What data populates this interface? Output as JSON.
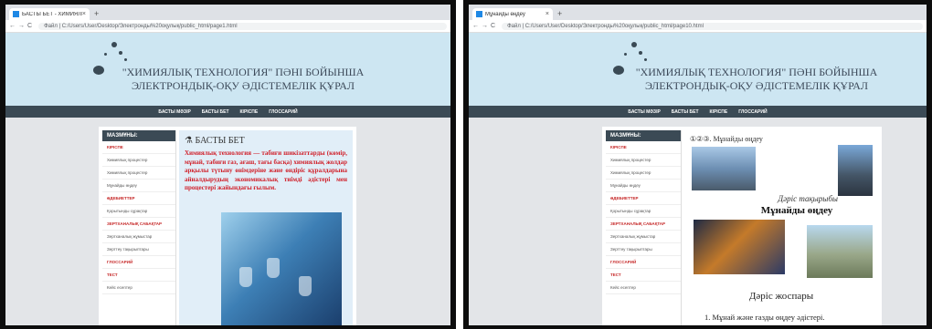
{
  "left": {
    "tab_title": "БАСТЫ БЕТ - ХИМИЯЛЫҚ Т",
    "address": "Файл | C:/Users/User/Desktop/Электронды%20оқулық/public_html/page1.html",
    "site_title_line1": "\"ХИМИЯЛЫҚ ТЕХНОЛОГИЯ\" ПӘНІ БОЙЫНША",
    "site_title_line2": "ЭЛЕКТРОНДЫҚ-ОҚУ ӘДІСТЕМЕЛІК ҚҰРАЛ",
    "menu": [
      "БАСТЫ МӘЗІР",
      "БАСТЫ БЕТ",
      "КІРІСПЕ",
      "ГЛОССАРИЙ"
    ],
    "sidebar_head": "МАЗМҰНЫ:",
    "sidebar_items": [
      "КІРІСПЕ",
      "Химиялық процестер",
      "Химиялық процестер",
      "Мұнайды өңдеу",
      "ӘДЕБИЕТТЕР",
      "Қорытынды сұрақтар",
      "ЗЕРТХАНАЛЫҚ САБАҚТАР",
      "Зертханалық жұмыстар",
      "Зерттеу тақырыптары",
      "ГЛОССАРИЙ",
      "ТЕСТ",
      "Кейс есептер"
    ],
    "page_heading": "БАСТЫ БЕТ",
    "lead_text": "Химиялық технология — табиғи шикізаттарды (көмір, мұнай, табиғи газ, ағаш, тағы басқа) химиялық жолдар арқылы түтыну өнімдеріне және өндіріс құралдарына айналдырудың экономикалық тиімді әдістері мен процестері жайындағы ғылым."
  },
  "right": {
    "tab_title": "Мұнайды өңдеу",
    "address": "Файл | C:/Users/User/Desktop/Электронды%20оқулық/public_html/page10.html",
    "site_title_line1": "\"ХИМИЯЛЫҚ ТЕХНОЛОГИЯ\" ПӘНІ БОЙЫНША",
    "site_title_line2": "ЭЛЕКТРОНДЫҚ-ОҚУ ӘДІСТЕМЕЛІК ҚҰРАЛ",
    "menu": [
      "БАСТЫ МӘЗІР",
      "БАСТЫ БЕТ",
      "КІРІСПЕ",
      "ГЛОССАРИЙ"
    ],
    "sidebar_head": "МАЗМҰНЫ:",
    "sidebar_items": [
      "КІРІСПЕ",
      "Химиялық процестер",
      "Химиялық процестер",
      "Мұнайды өңдеу",
      "ӘДЕБИЕТТЕР",
      "Қорытынды сұрақтар",
      "ЗЕРТХАНАЛЫҚ САБАҚТАР",
      "Зертханалық жұмыстар",
      "Зерттеу тақырыптары",
      "ГЛОССАРИЙ",
      "ТЕСТ",
      "Кейс есептер"
    ],
    "page_heading": "①②③. Мұнайды өңдеу",
    "lecture_topic_label": "Дәріс тақырыбы",
    "lecture_topic": "Мұнайды өңдеу",
    "lecture_plan": "Дәріс жоспары",
    "plan_item": "1. Мұнай және газды өңдеу әдістері."
  },
  "colors": {
    "banner": "#cde6f2",
    "menu": "#3b4a55",
    "accent_red": "#d0202a"
  }
}
